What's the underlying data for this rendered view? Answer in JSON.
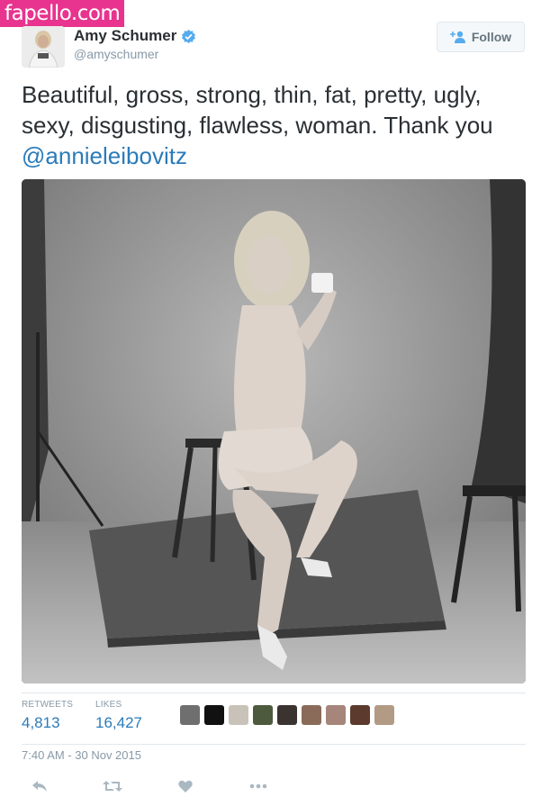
{
  "watermark": "fapello.com",
  "user": {
    "name": "Amy Schumer",
    "handle": "@amyschumer",
    "verified": true
  },
  "follow_button": {
    "label": "Follow"
  },
  "tweet": {
    "text": "Beautiful, gross, strong, thin, fat, pretty, ugly, sexy, disgusting, flawless, woman. Thank you",
    "mention": "@annieleibovitz"
  },
  "stats": {
    "retweets_label": "RETWEETS",
    "retweets": "4,813",
    "likes_label": "LIKES",
    "likes": "16,427"
  },
  "timestamp": "7:40 AM - 30 Nov 2015",
  "actions": [
    "reply-icon",
    "retweet-icon",
    "like-icon",
    "more-icon"
  ],
  "colors": {
    "link": "#2b7bb9",
    "muted": "#8899a6",
    "verified": "#55acee",
    "watermark": "#e8338f"
  }
}
